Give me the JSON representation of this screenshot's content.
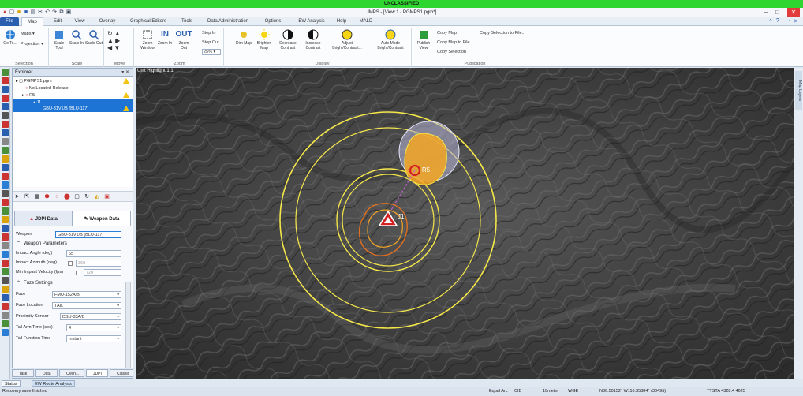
{
  "classification": "UNCLASSIFIED",
  "window": {
    "title": "JMPS - [View 1 - PGMPS1.pgm*]",
    "controls": [
      "–",
      "□",
      "✕"
    ]
  },
  "tabs": [
    "File",
    "Map",
    "Edit",
    "View",
    "Overlay",
    "Graphical Editors",
    "Tools",
    "Data Administration",
    "Options",
    "EW Analysis",
    "Help",
    "MALD"
  ],
  "active_tab": "Map",
  "ribbon": {
    "groups": [
      {
        "label": "Selection",
        "buttons": [
          "Go To...",
          "Maps",
          "Projection"
        ]
      },
      {
        "label": "Scale",
        "buttons": [
          "Scale Tool",
          "Scale In",
          "Scale Out"
        ]
      },
      {
        "label": "Move",
        "buttons": []
      },
      {
        "label": "Zoom",
        "buttons": [
          "Zoom Window",
          "Zoom In",
          "Zoom Out"
        ],
        "side": [
          "Step In",
          "Step Out",
          "25%"
        ]
      },
      {
        "label": "Display",
        "buttons": [
          "Dim Map",
          "Brighten Map",
          "Decrease Contrast",
          "Increase Contrast",
          "Adjust Bright/Contrast...",
          "Auto Mode Bright/Contrast"
        ]
      },
      {
        "label": "Publication",
        "buttons": [
          "Publish View"
        ],
        "side": [
          "Copy Map",
          "Copy Map to File...",
          "Copy Selection"
        ],
        "side2": [
          "Copy Selection to File..."
        ]
      }
    ]
  },
  "explorer": {
    "title": "Explorer",
    "tree": [
      {
        "label": "PGMPS1.pgm",
        "indent": 0,
        "warn": true,
        "selected": false
      },
      {
        "label": "No Located Release",
        "indent": 1,
        "warn": false,
        "selected": false
      },
      {
        "label": "R5",
        "indent": 1,
        "warn": true,
        "selected": false
      },
      {
        "label": "J1",
        "indent": 2,
        "warn": false,
        "selected": true
      },
      {
        "label": "GBU-31V1/B (BLU-117)",
        "indent": 3,
        "warn": true,
        "selected": true
      }
    ]
  },
  "panel_tabs": [
    "JDPI Data",
    "Weapon Data"
  ],
  "active_panel_tab": "Weapon Data",
  "form": {
    "weapon_label": "Weapon",
    "weapon_value": "GBU-31V1/B (BLU-117)",
    "weapon_params_title": "Weapon Parameters",
    "impact_angle_label": "Impact Angle (deg)",
    "impact_angle_value": "65",
    "impact_azimuth_label": "Impact Azimuth (deg)",
    "impact_azimuth_value": "360",
    "min_velocity_label": "Min Impact Velocity (fps)",
    "min_velocity_value": "720",
    "fuze_title": "Fuze Settings",
    "fuze_label": "Fuze",
    "fuze_value": "FMU-152A/B",
    "fuze_location_label": "Fuze Location",
    "fuze_location_value": "TAIL",
    "proximity_label": "Proximity Sensor",
    "proximity_value": "DSU-33A/B",
    "tail_arm_label": "Tail Arm Time (sec)",
    "tail_arm_value": "4",
    "tail_function_label": "Tail Function Time",
    "tail_function_value": "Instant"
  },
  "bottom_tabs": [
    "Task",
    "Data",
    "Overl...",
    "JDPI",
    "Classic"
  ],
  "map": {
    "label": "Unit Highlight 1:1",
    "markers": [
      {
        "name": "R5",
        "kind": "release"
      },
      {
        "name": "J1",
        "kind": "target"
      }
    ]
  },
  "right_strip_label": "Map Layers",
  "status_tabs": [
    "Status",
    "EW Route Analysis"
  ],
  "status": {
    "message": "Recovery save finished",
    "equal_arc": "Equal Arc",
    "cib": "CIB",
    "scale": "10meter",
    "datum": "WGE",
    "coords": "N36.50152° W116.35884° (3049ft)",
    "extra": "TTSTA 4328.4 4625"
  },
  "colors": {
    "classification_bg": "#2fd62f",
    "file_tab": "#2a5fb0",
    "ring_yellow": "#f5e74a",
    "ring_orange": "#f5a623",
    "release_red": "#d42020"
  }
}
